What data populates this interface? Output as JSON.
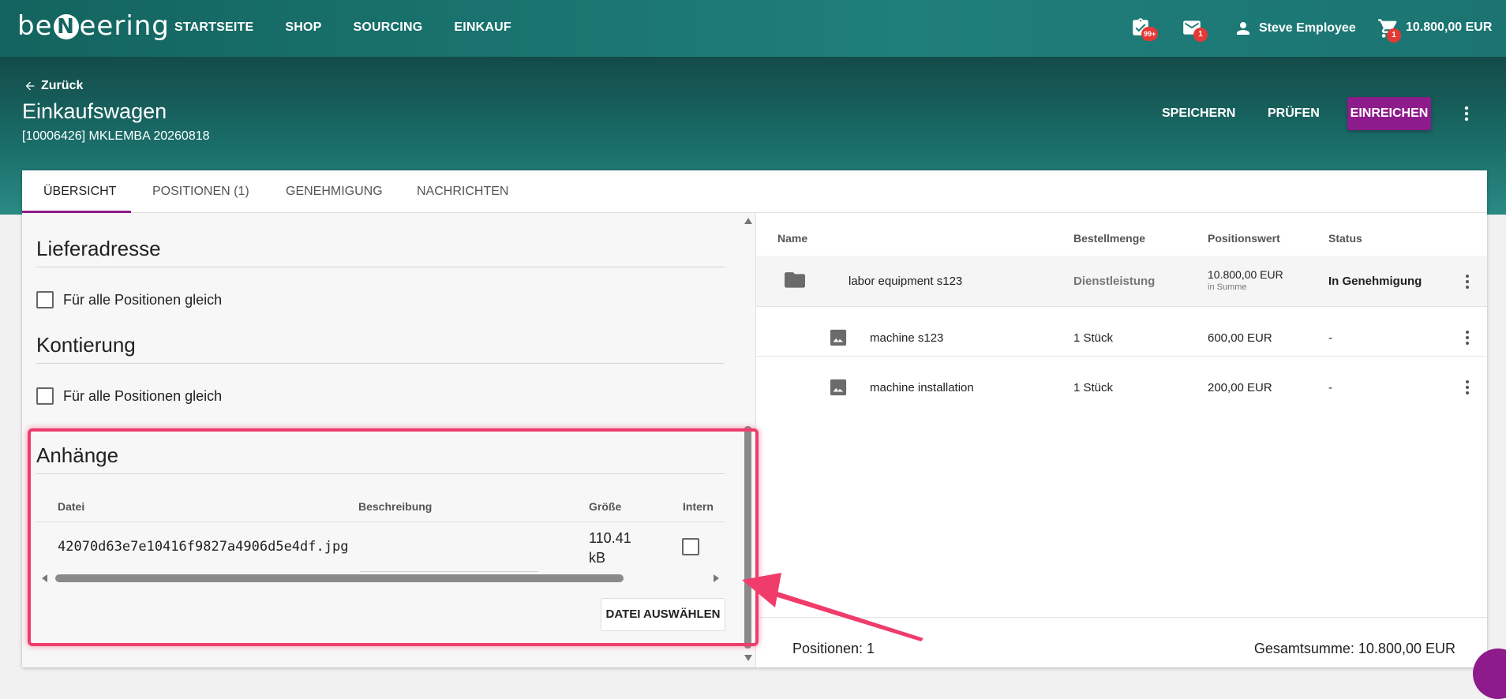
{
  "header": {
    "logo": {
      "pre": "be",
      "mid": "N",
      "post": "eering"
    },
    "nav": [
      "STARTSEITE",
      "SHOP",
      "SOURCING",
      "EINKAUF"
    ],
    "approvals_badge": "99+",
    "mail_badge": "1",
    "user_name": "Steve Employee",
    "cart_badge": "1",
    "cart_total": "10.800,00 EUR"
  },
  "page": {
    "back": "Zurück",
    "title": "Einkaufswagen",
    "subtitle": "[10006426] MKLEMBA 20260818",
    "actions": {
      "save": "SPEICHERN",
      "check": "PRÜFEN",
      "submit": "EINREICHEN"
    }
  },
  "tabs": [
    "ÜBERSICHT",
    "POSITIONEN (1)",
    "GENEHMIGUNG",
    "NACHRICHTEN"
  ],
  "left": {
    "delivery_title": "Lieferadresse",
    "delivery_checkbox": "Für alle Positionen gleich",
    "account_title": "Kontierung",
    "account_checkbox": "Für alle Positionen gleich",
    "attachments": {
      "title": "Anhänge",
      "columns": [
        "Datei",
        "Beschreibung",
        "Größe",
        "Intern"
      ],
      "file": "42070d63e7e10416f9827a4906d5e4df.jpg",
      "size_value": "110.41",
      "size_unit": "kB",
      "select_button": "DATEI AUSWÄHLEN"
    }
  },
  "positions": {
    "columns": [
      "Name",
      "Bestellmenge",
      "Positionswert",
      "Status"
    ],
    "rows": [
      {
        "name": "labor equipment s123",
        "qty": "Dienstleistung",
        "value": "10.800,00 EUR",
        "value_note": "in Summe",
        "status": "In Genehmigung"
      },
      {
        "name": "machine s123",
        "qty": "1 Stück",
        "value": "600,00 EUR",
        "status": "-"
      },
      {
        "name": "machine installation",
        "qty": "1 Stück",
        "value": "200,00 EUR",
        "status": "-"
      }
    ],
    "footer_count": "Positionen: 1",
    "footer_total": "Gesamtsumme: 10.800,00 EUR"
  },
  "colors": {
    "primary": "#13645f",
    "accent": "#8e1b8b",
    "highlight": "#ef3c6b",
    "badge": "#e53935"
  },
  "icons": [
    "arrow-left-icon",
    "task-check-icon",
    "mail-icon",
    "person-icon",
    "cart-icon",
    "more-vert-icon",
    "folder-icon",
    "image-icon",
    "chat-icon"
  ]
}
